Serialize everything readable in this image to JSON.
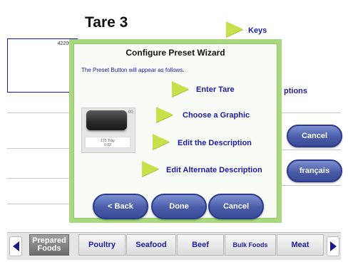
{
  "screen": {
    "title": "Tare 3",
    "left_panel_label": "422000",
    "keys_label": "Keys",
    "options_label": "ptions",
    "cancel_label": "Cancel",
    "language_label": "français"
  },
  "categories": {
    "items": [
      {
        "label": "Prepared Foods"
      },
      {
        "label": "Poultry"
      },
      {
        "label": "Seafood"
      },
      {
        "label": "Beef"
      },
      {
        "label": "Bulk Foods"
      },
      {
        "label": "Meat"
      }
    ],
    "active_index": 0
  },
  "dialog": {
    "title": "Configure Preset Wizard",
    "instruction": "The Preset Button will appear as follows.",
    "preview": {
      "corner_text": "00",
      "desc_line1": "175 Tray",
      "desc_line2": "0.02"
    },
    "options": [
      {
        "label": "Enter Tare"
      },
      {
        "label": "Choose a Graphic"
      },
      {
        "label": "Edit the Description"
      },
      {
        "label": "Edit Alternate Description"
      }
    ],
    "buttons": {
      "back": "< Back",
      "done": "Done",
      "cancel": "Cancel"
    }
  },
  "colors": {
    "accent_arrow": "#c8e04a",
    "dialog_border": "#a9d87e",
    "button_blue": "#4a5ca8",
    "text_blue": "#1a1aa8"
  }
}
